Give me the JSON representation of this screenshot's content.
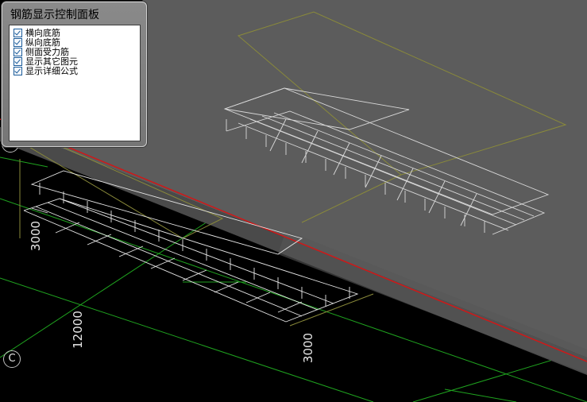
{
  "panel": {
    "title": "钢筋显示控制面板",
    "options": [
      {
        "label": "横向底筋",
        "checked": true
      },
      {
        "label": "纵向底筋",
        "checked": true
      },
      {
        "label": "侧面受力筋",
        "checked": true
      },
      {
        "label": "显示其它图元",
        "checked": true
      },
      {
        "label": "显示详细公式",
        "checked": true
      }
    ]
  },
  "dimensions": {
    "left_3000": "3000",
    "span_12000": "12000",
    "bottom_3000": "3000"
  },
  "axes": {
    "bubble_c": "C"
  },
  "colors": {
    "background": "#000000",
    "slab": "#5a5a5a",
    "slab_face": "#4a4a4a",
    "rebar": "#e6e6e6",
    "red_axis": "#d01818",
    "grid_green": "#1fa31f",
    "outline_olive": "#8a8a3a"
  },
  "icons": [
    "checkbox-icon"
  ]
}
